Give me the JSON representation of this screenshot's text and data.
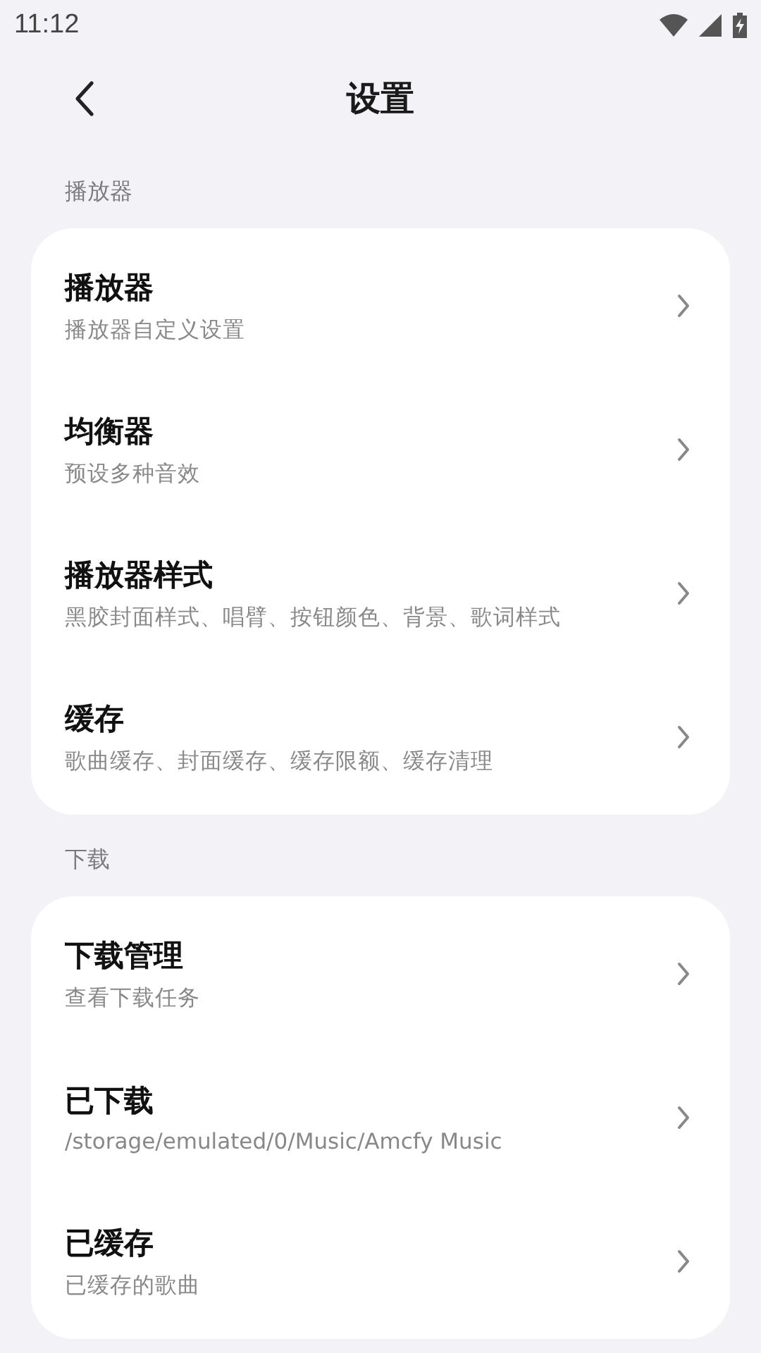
{
  "status_bar": {
    "time": "11:12"
  },
  "header": {
    "title": "设置"
  },
  "sections": [
    {
      "label": "播放器",
      "items": [
        {
          "title": "播放器",
          "subtitle": "播放器自定义设置"
        },
        {
          "title": "均衡器",
          "subtitle": "预设多种音效"
        },
        {
          "title": "播放器样式",
          "subtitle": "黑胶封面样式、唱臂、按钮颜色、背景、歌词样式"
        },
        {
          "title": "缓存",
          "subtitle": "歌曲缓存、封面缓存、缓存限额、缓存清理"
        }
      ]
    },
    {
      "label": "下载",
      "items": [
        {
          "title": "下载管理",
          "subtitle": "查看下载任务"
        },
        {
          "title": "已下载",
          "subtitle": "/storage/emulated/0/Music/Amcfy Music"
        },
        {
          "title": "已缓存",
          "subtitle": "已缓存的歌曲"
        }
      ]
    }
  ]
}
